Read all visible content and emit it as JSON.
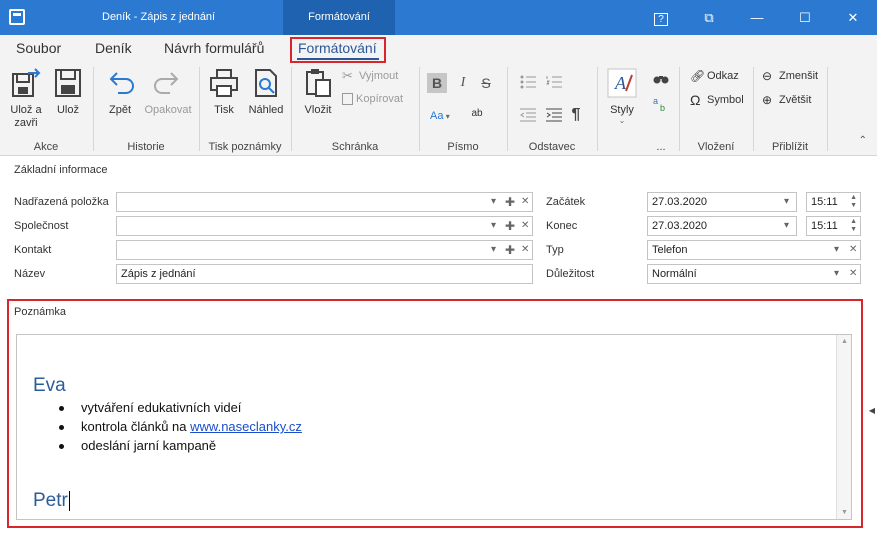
{
  "titlebar": {
    "title": "Deník - Zápis z jednání",
    "context_tab": "Formátování",
    "help": "?",
    "restore": "⧉",
    "minimize": "—",
    "maximize": "☐",
    "close": "✕"
  },
  "tabs": [
    "Soubor",
    "Deník",
    "Návrh formulářů",
    "Formátování"
  ],
  "ribbon": {
    "akce": {
      "label": "Akce",
      "save_close": "Ulož a zavři",
      "save": "Ulož"
    },
    "historie": {
      "label": "Historie",
      "undo": "Zpět",
      "redo": "Opakovat"
    },
    "tisk": {
      "label": "Tisk poznámky",
      "print": "Tisk",
      "preview": "Náhled"
    },
    "schranka": {
      "label": "Schránka",
      "paste": "Vložit",
      "cut": "Vyjmout",
      "copy": "Kopírovat"
    },
    "pismo": {
      "label": "Písmo",
      "bold": "B",
      "italic": "I",
      "strike": "S",
      "font_size": "Aa",
      "highlight": "ab"
    },
    "odstavec": {
      "label": "Odstavec",
      "pilcrow": "¶"
    },
    "styly": {
      "label": "...",
      "styles": "Styly"
    },
    "vlozeni": {
      "label": "Vložení",
      "link": "Odkaz",
      "symbol": "Symbol"
    },
    "priblizit": {
      "label": "Přiblížit",
      "zoom_out": "Zmenšit",
      "zoom_in": "Zvětšit"
    }
  },
  "form": {
    "section_title": "Základní informace",
    "labels": {
      "parent": "Nadřazená položka",
      "company": "Společnost",
      "contact": "Kontakt",
      "name": "Název",
      "start": "Začátek",
      "end": "Konec",
      "type": "Typ",
      "priority": "Důležitost"
    },
    "values": {
      "parent": "",
      "company": "",
      "contact": "",
      "name": "Zápis z jednání",
      "start_date": "27.03.2020",
      "start_time": "15:11",
      "end_date": "27.03.2020",
      "end_time": "15:11",
      "type": "Telefon",
      "priority": "Normální"
    }
  },
  "notes": {
    "label": "Poznámka",
    "heading1": "Eva",
    "bullets": [
      "vytváření edukativních videí",
      "kontrola článků na",
      "odeslání jarní kampaně"
    ],
    "link": "www.naseclanky.cz",
    "heading2": "Petr"
  }
}
